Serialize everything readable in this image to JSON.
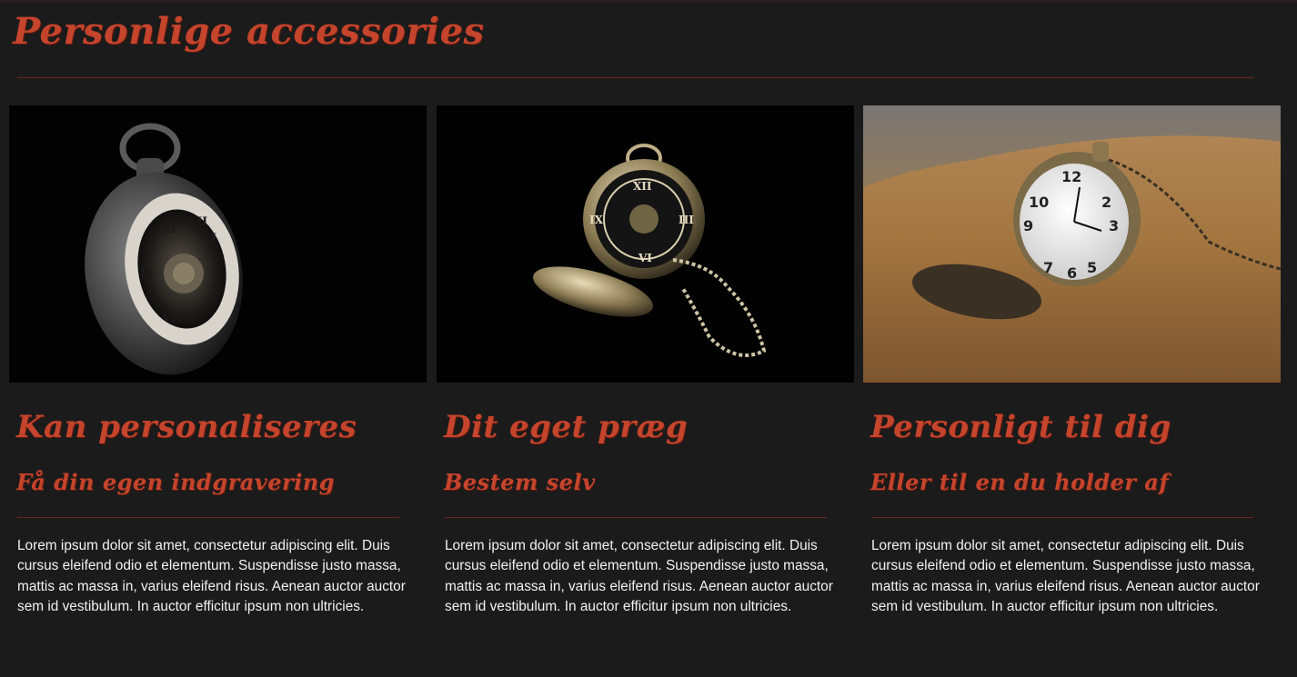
{
  "page": {
    "title": "Personlige accessories"
  },
  "cards": [
    {
      "image_alt": "pocket-watch-dark-icon",
      "heading": "Kan personaliseres",
      "subheading": "Få din egen indgravering",
      "text": "Lorem ipsum dolor sit amet, consectetur adipiscing elit. Duis cursus eleifend odio et elementum. Suspendisse justo massa, mattis ac massa in, varius eleifend risus. Aenean auctor auctor sem id vestibulum. In auctor efficitur ipsum non ultricies."
    },
    {
      "image_alt": "pocket-watch-open-icon",
      "heading": "Dit eget præg",
      "subheading": "Bestem selv",
      "text": "Lorem ipsum dolor sit amet, consectetur adipiscing elit. Duis cursus eleifend odio et elementum. Suspendisse justo massa, mattis ac massa in, varius eleifend risus. Aenean auctor auctor sem id vestibulum. In auctor efficitur ipsum non ultricies."
    },
    {
      "image_alt": "pocket-watch-sand-icon",
      "heading": "Personligt til dig",
      "subheading": "Eller til en du holder af",
      "text": "Lorem ipsum dolor sit amet, consectetur adipiscing elit. Duis cursus eleifend odio et elementum. Suspendisse justo massa, mattis ac massa in, varius eleifend risus. Aenean auctor auctor sem id vestibulum. In auctor efficitur ipsum non ultricies."
    }
  ],
  "colors": {
    "background": "#1b1b1b",
    "accent": "#c5442c",
    "divider": "#6b2418",
    "body_text": "#f2f2f2"
  }
}
